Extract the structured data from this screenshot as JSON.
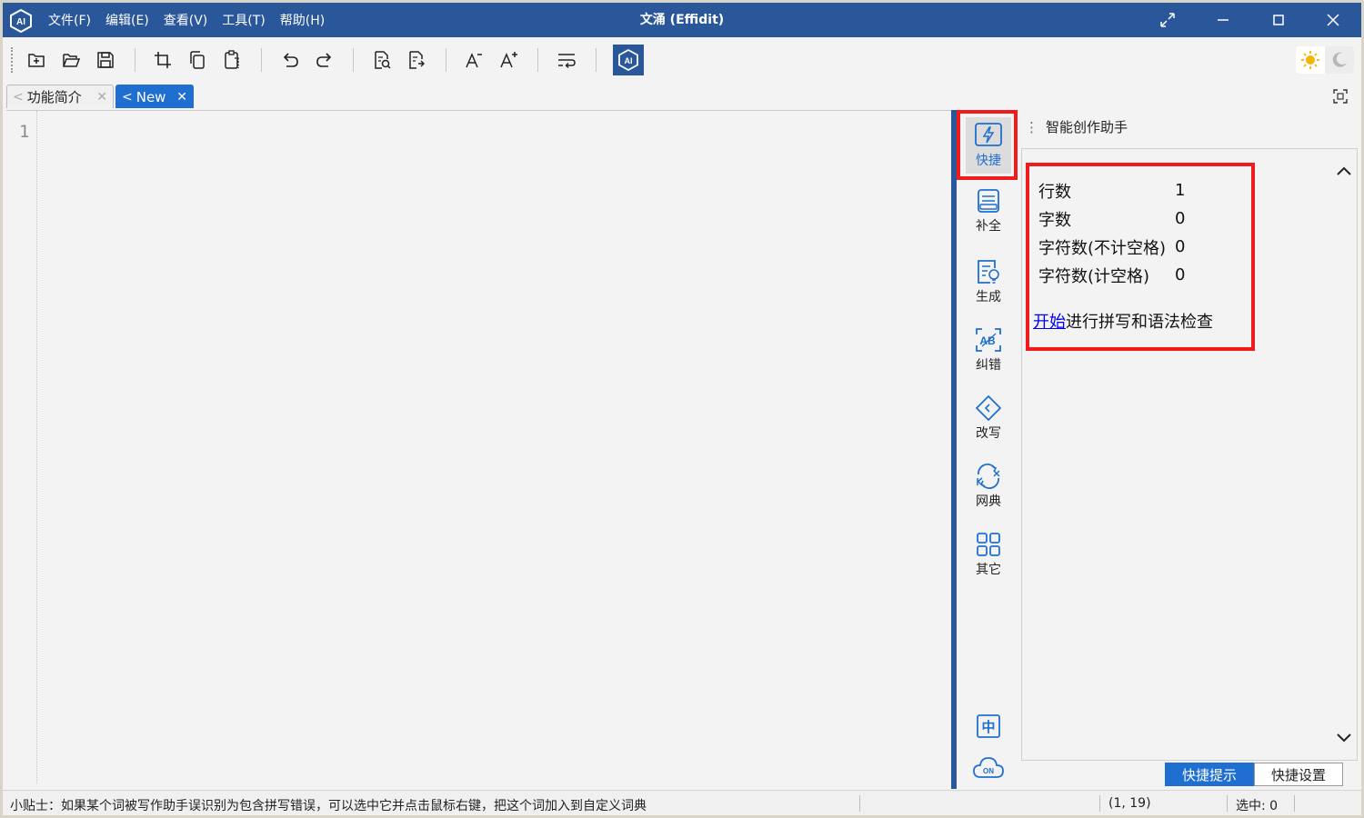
{
  "window": {
    "title": "文涌 (Effidit)",
    "menu": [
      "文件(F)",
      "编辑(E)",
      "查看(V)",
      "工具(T)",
      "帮助(H)"
    ],
    "logo_text": "AI"
  },
  "toolbar": {
    "icons": [
      "new-file-icon",
      "open-folder-icon",
      "save-icon",
      "crop-icon",
      "copy-icon",
      "paste-icon",
      "undo-icon",
      "redo-icon",
      "find-document-icon",
      "replace-document-icon",
      "decrease-font-icon",
      "increase-font-icon",
      "word-wrap-icon",
      "ai-assistant-icon"
    ],
    "theme": {
      "light": "sun-icon",
      "dark": "moon-icon"
    }
  },
  "tabs": [
    {
      "label": "功能简介",
      "prefix": "<",
      "active": false
    },
    {
      "label": "New",
      "prefix": "<",
      "active": true
    }
  ],
  "editor": {
    "line_numbers": [
      "1"
    ],
    "content": ""
  },
  "sidebar": {
    "items": [
      {
        "label": "快捷",
        "icon": "lightning-icon",
        "active": true
      },
      {
        "label": "补全",
        "icon": "complete-icon",
        "active": false
      },
      {
        "label": "生成",
        "icon": "generate-icon",
        "active": false
      },
      {
        "label": "纠错",
        "icon": "correct-icon",
        "active": false
      },
      {
        "label": "改写",
        "icon": "rewrite-icon",
        "active": false
      },
      {
        "label": "网典",
        "icon": "dictionary-icon",
        "active": false
      },
      {
        "label": "其它",
        "icon": "grid-icon",
        "active": false
      }
    ],
    "bottom": [
      {
        "icon": "chinese-ime-icon",
        "text": "中"
      },
      {
        "icon": "cloud-on-icon",
        "text": "ON"
      }
    ]
  },
  "assistant": {
    "title": "智能创作助手",
    "stats": [
      {
        "label": "行数",
        "value": "1"
      },
      {
        "label": "字数",
        "value": "0"
      },
      {
        "label": "字符数(不计空格)",
        "value": "0"
      },
      {
        "label": "字符数(计空格)",
        "value": "0"
      }
    ],
    "check_link": "开始",
    "check_text": "进行拼写和语法检查",
    "bottom_tabs": [
      {
        "label": "快捷提示",
        "active": true
      },
      {
        "label": "快捷设置",
        "active": false
      }
    ]
  },
  "statusbar": {
    "tip": "小贴士：如果某个词被写作助手误识别为包含拼写错误，可以选中它并点击鼠标右键，把这个词加入到自定义词典",
    "position": "(1, 19)",
    "selection": "选中: 0"
  },
  "colors": {
    "titlebar": "#2a5799",
    "accent": "#1f6fd0",
    "highlight": "#ee1c1c"
  }
}
